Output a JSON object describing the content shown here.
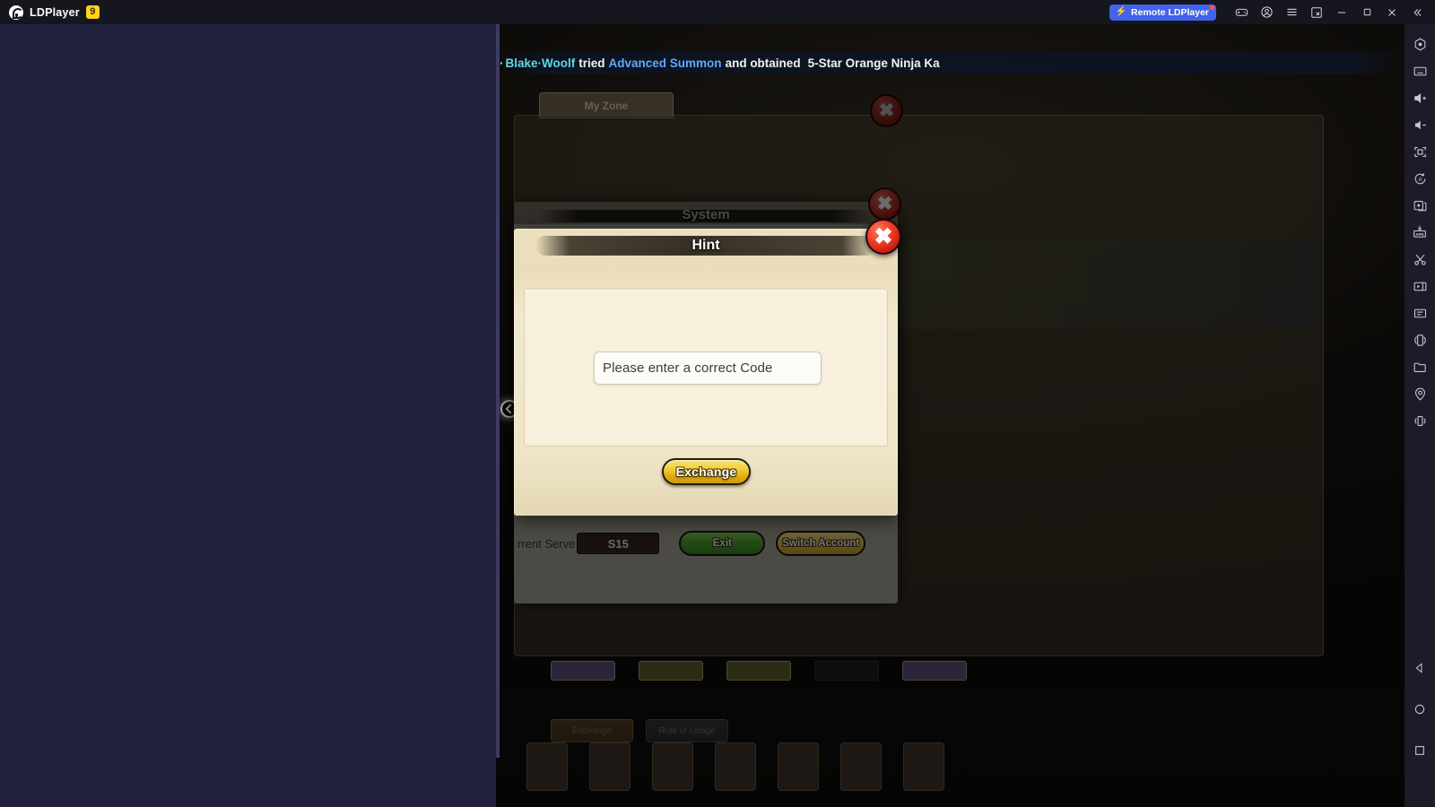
{
  "titlebar": {
    "brand_name": "LDPlayer",
    "brand_badge": "9",
    "remote_label": "Remote LDPlayer",
    "bolt_icon": "lightning-bolt-icon",
    "buttons": [
      {
        "name": "gamepad-icon",
        "label": ""
      },
      {
        "name": "account-icon",
        "label": ""
      },
      {
        "name": "menu-icon",
        "label": ""
      },
      {
        "name": "new-instance-icon",
        "label": ""
      },
      {
        "name": "minimize-icon",
        "label": ""
      },
      {
        "name": "maximize-icon",
        "label": ""
      },
      {
        "name": "close-icon",
        "label": ""
      },
      {
        "name": "collapse-icon",
        "label": ""
      }
    ]
  },
  "rail": {
    "items": [
      {
        "name": "back-hexagon-icon"
      },
      {
        "name": "keyboard-icon"
      },
      {
        "name": "volume-up-icon"
      },
      {
        "name": "volume-down-icon"
      },
      {
        "name": "fullscreen-icon"
      },
      {
        "name": "auto-rotate-icon"
      },
      {
        "name": "multi-instance-icon"
      },
      {
        "name": "install-apk-icon"
      },
      {
        "name": "screenshot-scissors-icon"
      },
      {
        "name": "screen-record-icon"
      },
      {
        "name": "synchronizer-icon"
      },
      {
        "name": "rotate-screen-icon"
      },
      {
        "name": "file-manager-icon"
      },
      {
        "name": "location-pin-icon"
      },
      {
        "name": "shake-icon"
      }
    ],
    "nav": [
      {
        "name": "android-back-icon"
      },
      {
        "name": "android-home-icon"
      },
      {
        "name": "android-recents-icon"
      }
    ]
  },
  "game": {
    "ticker": {
      "prefix_dot": "·",
      "player_name": "Blake·Woolf",
      "verb": "tried",
      "action": "Advanced Summon",
      "connector": "and obtained",
      "reward": "5-Star Orange Ninja Ka"
    },
    "background_tab": "My Zone",
    "background_buttons": [
      {
        "label": "Exchange"
      },
      {
        "label": "Rule of Usage"
      }
    ]
  },
  "system_dialog": {
    "title": "System",
    "current_server_label": "rrent Serve",
    "server_value": "S15",
    "exit_label": "Exit",
    "switch_account_label": "Switch Account"
  },
  "hint_dialog": {
    "title": "Hint",
    "message": "Please enter a correct Code",
    "exchange_label": "Exchange",
    "close_icon": "close-x-icon"
  },
  "colors": {
    "app_background": "#21213d",
    "titlebar": "#16161f",
    "rail": "#1c1c28",
    "remote_pill": "#4263eb",
    "brand_badge": "#ffd21e",
    "parchment": "#efe6c9",
    "parchment_inner": "#f7f0dd",
    "gold_button": "#e9c42f",
    "green_button": "#3fae17",
    "close_red": "#ef3a22",
    "ticker_name": "#5fd7e8",
    "ticker_link": "#5fa8ff"
  }
}
